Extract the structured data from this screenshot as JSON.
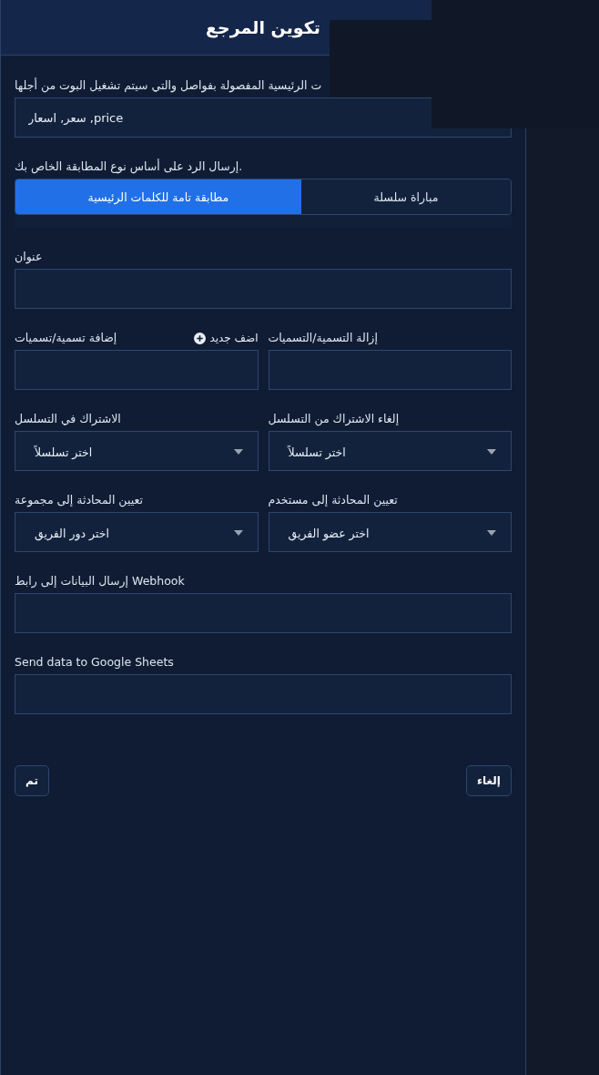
{
  "dialog": {
    "title": "تكوين المرجع"
  },
  "form": [
    {
      "kind": "text",
      "label": "ت الرئيسية المفصولة بفواصل والتي سيتم تشغيل البوت من أجلها",
      "value": "سعر, اسعار ,price"
    },
    {
      "kind": "segmented",
      "label": "إرسال الرد على أساس نوع المطابقة الخاص بك.",
      "options": [
        {
          "label": "مباراة سلسلة",
          "selected": false
        },
        {
          "label": "مطابقة تامة للكلمات الرئيسية",
          "selected": true
        }
      ]
    },
    {
      "kind": "text",
      "label": "عنوان"
    },
    {
      "kind": "pair",
      "fields": [
        {
          "kind": "text",
          "label": "إزالة التسمية/التسميات"
        },
        {
          "kind": "text",
          "label": "إضافة تسمية/تسميات",
          "link": "اضف جديد"
        }
      ]
    },
    {
      "kind": "pair",
      "fields": [
        {
          "kind": "select",
          "label": "إلغاء الاشتراك من التسلسل",
          "placeholder": "اختر تسلسلاً"
        },
        {
          "kind": "select",
          "label": "الاشتراك في التسلسل",
          "placeholder": "اختر تسلسلاً"
        }
      ]
    },
    {
      "kind": "pair",
      "fields": [
        {
          "kind": "select",
          "label": "تعيين المحادثة إلى مستخدم",
          "placeholder": "اختر عضو الفريق"
        },
        {
          "kind": "select",
          "label": "تعيين المحادثة إلى مجموعة",
          "placeholder": "اختر دور الفريق"
        }
      ]
    },
    {
      "kind": "text",
      "label": "إرسال البيانات إلى رابط Webhook"
    },
    {
      "kind": "text",
      "label": "Send data to Google Sheets"
    }
  ],
  "buttons": [
    {
      "label": "إلغاء"
    },
    {
      "label": "تم"
    }
  ]
}
